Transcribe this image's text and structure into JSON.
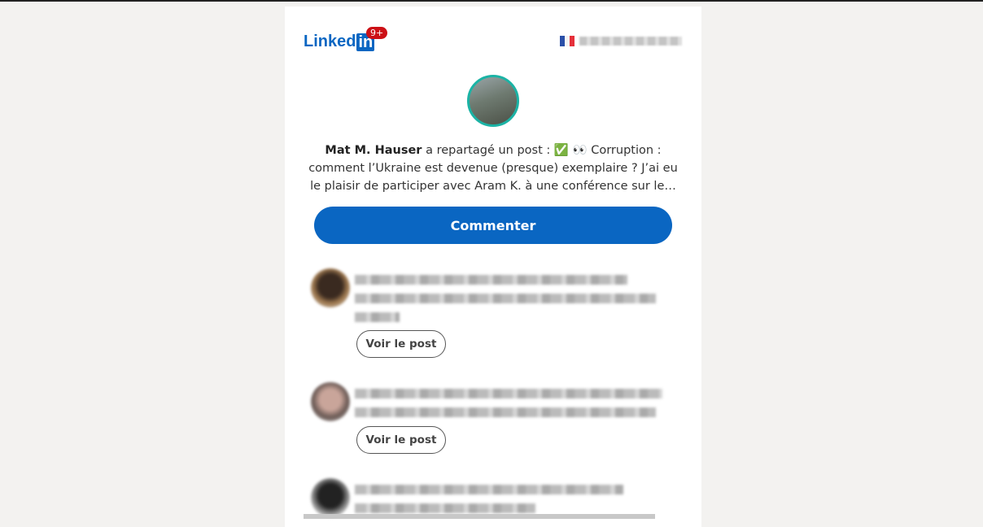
{
  "header": {
    "logo_text": "Linked",
    "logo_in": "in",
    "notification_badge": "9+",
    "flag_icon": "france-flag-icon"
  },
  "post": {
    "author": "Mat M. Hauser",
    "message": " a repartagé un post : ✅ 👀 Corruption : comment l’Ukraine est devenue (presque) exemplaire ? J’ai eu le plaisir de participer avec Aram K. à une conférence sur le…",
    "comment_button": "Commenter"
  },
  "items": [
    {
      "button": "Voir le post"
    },
    {
      "button": "Voir le post"
    }
  ],
  "colors": {
    "brand": "#0a66c2",
    "badge": "#cc1016",
    "avatar_ring": "#1bb3a5"
  }
}
